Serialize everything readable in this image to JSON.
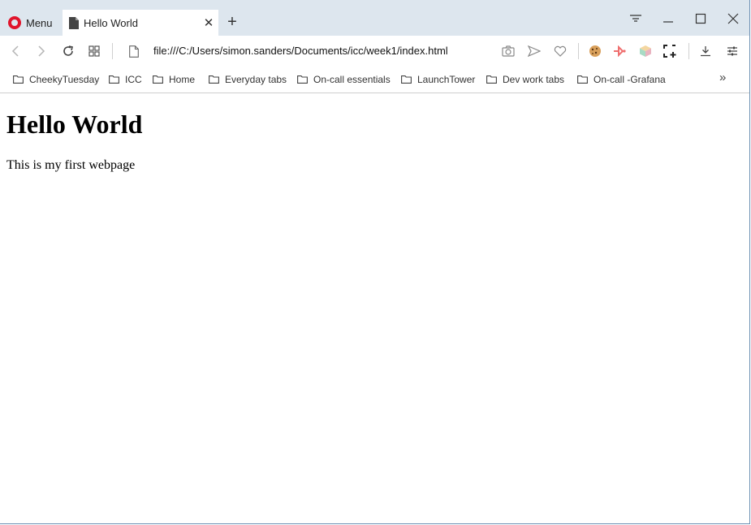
{
  "browser": {
    "menu_label": "Menu",
    "tab_title": "Hello World",
    "address": "file:///C:/Users/simon.sanders/Documents/icc/week1/index.html"
  },
  "bookmarks": [
    {
      "label": "CheekyTuesday"
    },
    {
      "label": "ICC"
    },
    {
      "label": "Home"
    },
    {
      "label": "Everyday tabs"
    },
    {
      "label": "On-call essentials"
    },
    {
      "label": "LaunchTower"
    },
    {
      "label": "Dev work tabs"
    },
    {
      "label": "On-call -Grafana"
    }
  ],
  "page": {
    "heading": "Hello World",
    "paragraph": "This is my first webpage"
  },
  "colors": {
    "brand": "#e0142b",
    "titlebar": "#dde6ee"
  },
  "icons": [
    "opera-logo-icon",
    "page-icon",
    "close-icon",
    "plus-icon",
    "tab-menu-icon",
    "minimize-icon",
    "maximize-icon",
    "window-close-icon",
    "back-icon",
    "forward-icon",
    "reload-icon",
    "speed-dial-icon",
    "file-icon",
    "camera-icon",
    "send-icon",
    "heart-icon",
    "cookie-icon",
    "extension-icon",
    "cube-icon",
    "snapshot-icon",
    "download-icon",
    "easy-setup-icon",
    "folder-icon",
    "chevron-double-right-icon"
  ]
}
